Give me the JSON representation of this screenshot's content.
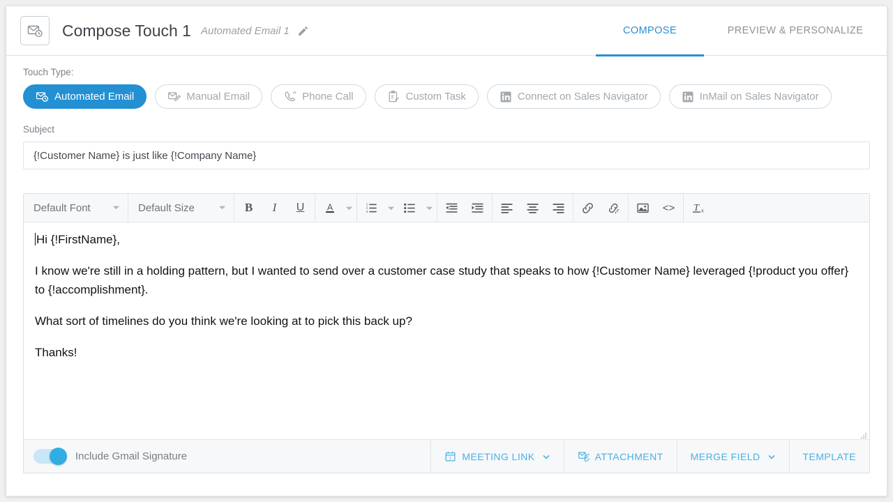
{
  "header": {
    "icon": "email-clock-icon",
    "title": "Compose Touch 1",
    "subtitle": "Automated Email 1",
    "edit_icon": "pencil-icon",
    "tabs": [
      {
        "label": "COMPOSE",
        "active": true
      },
      {
        "label": "PREVIEW & PERSONALIZE",
        "active": false
      }
    ]
  },
  "touch_type": {
    "label": "Touch Type:",
    "options": [
      {
        "label": "Automated Email",
        "icon": "email-clock-icon",
        "selected": true
      },
      {
        "label": "Manual Email",
        "icon": "email-pencil-icon",
        "selected": false
      },
      {
        "label": "Phone Call",
        "icon": "phone-icon",
        "selected": false
      },
      {
        "label": "Custom Task",
        "icon": "clipboard-check-icon",
        "selected": false
      },
      {
        "label": "Connect on Sales Navigator",
        "icon": "linkedin-icon",
        "selected": false
      },
      {
        "label": "InMail on Sales Navigator",
        "icon": "linkedin-icon",
        "selected": false
      }
    ]
  },
  "subject": {
    "label": "Subject",
    "value": "{!Customer Name} is just like {!Company Name}",
    "placeholder": "Subject"
  },
  "editor": {
    "toolbar": {
      "font_select": "Default Font",
      "size_select": "Default Size",
      "bold": "B",
      "italic": "I",
      "underline": "U",
      "font_color": "A",
      "numbered_list": "numbered-list-icon",
      "bulleted_list": "bulleted-list-icon",
      "outdent": "outdent-icon",
      "indent": "indent-icon",
      "align_left": "align-left-icon",
      "align_center": "align-center-icon",
      "align_right": "align-right-icon",
      "link": "link-icon",
      "unlink": "unlink-icon",
      "image": "image-icon",
      "source_code": "<>",
      "clear_format": "clear-formatting-icon"
    },
    "body": {
      "line1": "Hi {!FirstName},",
      "line2": "I know we're still in a holding pattern, but I wanted to send over a customer case study that speaks to how {!Customer Name} leveraged {!product you offer} to {!accomplishment}.",
      "line3": "What sort of timelines do you think we're looking at to pick this back up?",
      "line4": "Thanks!"
    }
  },
  "footer": {
    "signature_toggle_label": "Include Gmail Signature",
    "signature_toggle_on": true,
    "buttons": [
      {
        "label": "MEETING LINK",
        "icon": "calendar-icon",
        "caret": true
      },
      {
        "label": "ATTACHMENT",
        "icon": "attachment-icon",
        "caret": false
      },
      {
        "label": "MERGE FIELD",
        "icon": "",
        "caret": true
      },
      {
        "label": "TEMPLATE",
        "icon": "",
        "caret": false
      }
    ]
  },
  "colors": {
    "accent_blue": "#2290d2",
    "light_blue": "#49b0e6",
    "toggle_blue": "#31ade4",
    "muted_gray": "#a2a8ae"
  }
}
